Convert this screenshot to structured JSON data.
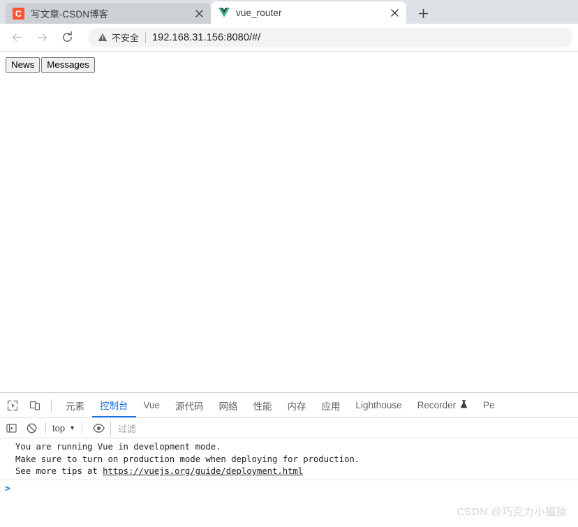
{
  "browser": {
    "tabs": [
      {
        "title": "写文章-CSDN博客",
        "favicon": "csdn-c-icon",
        "favicon_letter": "C",
        "active": false,
        "close_label": "×"
      },
      {
        "title": "vue_router",
        "favicon": "vue-logo-icon",
        "active": true,
        "close_label": "×"
      }
    ],
    "new_tab_label": "+",
    "toolbar": {
      "back_label": "←",
      "forward_label": "→",
      "reload_label": "⟳",
      "security_icon": "warning-triangle-icon",
      "security_text": "不安全",
      "url": "192.168.31.156:8080/#/"
    }
  },
  "page": {
    "buttons": [
      {
        "label": "News"
      },
      {
        "label": "Messages"
      }
    ]
  },
  "devtools": {
    "toolbar_icons": [
      {
        "name": "inspect-element-icon"
      },
      {
        "name": "device-toolbar-icon"
      }
    ],
    "tabs": [
      {
        "label": "元素",
        "selected": false
      },
      {
        "label": "控制台",
        "selected": true
      },
      {
        "label": "Vue",
        "selected": false
      },
      {
        "label": "源代码",
        "selected": false
      },
      {
        "label": "网络",
        "selected": false
      },
      {
        "label": "性能",
        "selected": false
      },
      {
        "label": "内存",
        "selected": false
      },
      {
        "label": "应用",
        "selected": false
      },
      {
        "label": "Lighthouse",
        "selected": false
      },
      {
        "label": "Recorder",
        "selected": false,
        "badge": "⚗"
      },
      {
        "label": "Pe",
        "selected": false
      }
    ],
    "console_toolbar": {
      "sidebar_icon": "console-sidebar-icon",
      "clear_icon": "clear-console-icon",
      "context_value": "top",
      "context_caret": "▼",
      "eye_icon": "live-expression-eye-icon",
      "filter_placeholder": "过滤"
    },
    "console_messages": [
      "You are running Vue in development mode.",
      "Make sure to turn on production mode when deploying for production.",
      "See more tips at "
    ],
    "console_link": "https://vuejs.org/guide/deployment.html",
    "prompt_symbol": ">"
  },
  "watermark": "CSDN @巧克力小猫猿",
  "colors": {
    "accent_blue": "#1a73e8",
    "tabstrip_bg": "#dee1e6",
    "inactive_tab": "#cdd1d6",
    "csdn_orange": "#fc5531",
    "vue_green": "#42b883",
    "vue_navy": "#35495e"
  }
}
